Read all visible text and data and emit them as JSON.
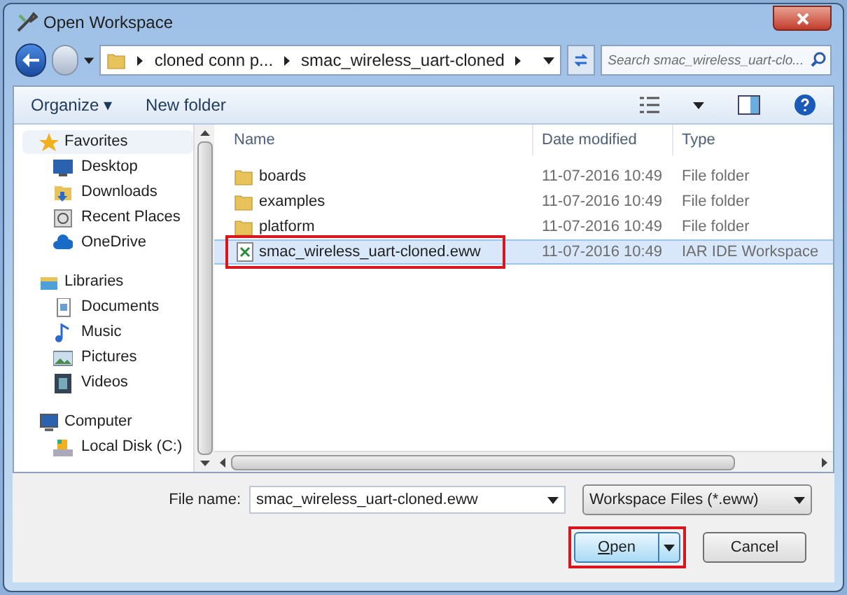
{
  "window": {
    "title": "Open Workspace"
  },
  "address": {
    "crumbs": [
      "cloned conn p...",
      "smac_wireless_uart-cloned"
    ]
  },
  "search": {
    "placeholder": "Search smac_wireless_uart-clo..."
  },
  "toolbar": {
    "organize": "Organize ▾",
    "new_folder": "New folder"
  },
  "sidebar": {
    "groups": [
      {
        "label": "Favorites",
        "children": [
          {
            "label": "Desktop"
          },
          {
            "label": "Downloads"
          },
          {
            "label": "Recent Places"
          },
          {
            "label": "OneDrive"
          }
        ]
      },
      {
        "label": "Libraries",
        "children": [
          {
            "label": "Documents"
          },
          {
            "label": "Music"
          },
          {
            "label": "Pictures"
          },
          {
            "label": "Videos"
          }
        ]
      },
      {
        "label": "Computer",
        "children": [
          {
            "label": "Local Disk (C:)"
          }
        ]
      }
    ]
  },
  "table": {
    "columns": [
      "Name",
      "Date modified",
      "Type"
    ],
    "rows": [
      {
        "name": "boards",
        "date": "11-07-2016 10:49",
        "type": "File folder",
        "kind": "folder",
        "selected": false,
        "highlighted": false
      },
      {
        "name": "examples",
        "date": "11-07-2016 10:49",
        "type": "File folder",
        "kind": "folder",
        "selected": false,
        "highlighted": false
      },
      {
        "name": "platform",
        "date": "11-07-2016 10:49",
        "type": "File folder",
        "kind": "folder",
        "selected": false,
        "highlighted": false
      },
      {
        "name": "smac_wireless_uart-cloned.eww",
        "date": "11-07-2016 10:49",
        "type": "IAR IDE Workspace",
        "kind": "file",
        "selected": true,
        "highlighted": true
      }
    ]
  },
  "file_name": {
    "label": "File name:",
    "value": "smac_wireless_uart-cloned.eww"
  },
  "file_type": {
    "value": "Workspace Files (*.eww)"
  },
  "buttons": [
    {
      "label": "Open",
      "kind": "split",
      "highlighted": true
    },
    {
      "label": "Cancel",
      "kind": "plain",
      "highlighted": false
    }
  ]
}
